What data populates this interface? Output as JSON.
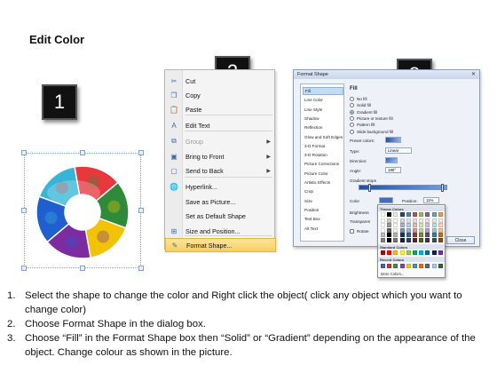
{
  "page": {
    "title": "Edit Color"
  },
  "badges": [
    "1",
    "2",
    "3"
  ],
  "context_menu": {
    "items": [
      {
        "icon": "cut-icon",
        "glyph": "✂",
        "label": "Cut",
        "submenu": false,
        "disabled": false,
        "highlighted": false
      },
      {
        "icon": "copy-icon",
        "glyph": "❐",
        "label": "Copy",
        "submenu": false,
        "disabled": false,
        "highlighted": false
      },
      {
        "icon": "paste-icon",
        "glyph": "📋",
        "label": "Paste",
        "submenu": false,
        "disabled": false,
        "highlighted": false
      },
      {
        "icon": "edit-text-icon",
        "glyph": "A",
        "label": "Edit Text",
        "submenu": false,
        "disabled": false,
        "highlighted": false
      },
      {
        "icon": "group-icon",
        "glyph": "⧉",
        "label": "Group",
        "submenu": true,
        "disabled": true,
        "highlighted": false
      },
      {
        "icon": "bring-to-front-icon",
        "glyph": "▣",
        "label": "Bring to Front",
        "submenu": true,
        "disabled": false,
        "highlighted": false
      },
      {
        "icon": "send-to-back-icon",
        "glyph": "▢",
        "label": "Send to Back",
        "submenu": true,
        "disabled": false,
        "highlighted": false
      },
      {
        "icon": "hyperlink-icon",
        "glyph": "🌐",
        "label": "Hyperlink...",
        "submenu": false,
        "disabled": false,
        "highlighted": false
      },
      {
        "icon": "",
        "glyph": "",
        "label": "Save as Picture...",
        "submenu": false,
        "disabled": false,
        "highlighted": false
      },
      {
        "icon": "",
        "glyph": "",
        "label": "Set as Default Shape",
        "submenu": false,
        "disabled": false,
        "highlighted": false
      },
      {
        "icon": "size-position-icon",
        "glyph": "⊞",
        "label": "Size and Position...",
        "submenu": false,
        "disabled": false,
        "highlighted": false
      },
      {
        "icon": "format-shape-icon",
        "glyph": "✎",
        "label": "Format Shape...",
        "submenu": false,
        "disabled": false,
        "highlighted": true
      }
    ]
  },
  "dialog": {
    "title": "Format Shape",
    "close_glyph": "✕",
    "nav": [
      "Fill",
      "Line Color",
      "Line Style",
      "Shadow",
      "Reflection",
      "Glow and Soft Edges",
      "3-D Format",
      "3-D Rotation",
      "Picture Corrections",
      "Picture Color",
      "Artistic Effects",
      "Crop",
      "Size",
      "Position",
      "Text Box",
      "Alt Text"
    ],
    "active_nav": "Fill",
    "section_title": "Fill",
    "fill_options": [
      {
        "label": "No fill",
        "selected": false
      },
      {
        "label": "Solid fill",
        "selected": false
      },
      {
        "label": "Gradient fill",
        "selected": true
      },
      {
        "label": "Picture or texture fill",
        "selected": false
      },
      {
        "label": "Pattern fill",
        "selected": false
      },
      {
        "label": "Slide background fill",
        "selected": false
      }
    ],
    "preset_colors_label": "Preset colors:",
    "type_label": "Type:",
    "type_value": "Linear",
    "direction_label": "Direction:",
    "angle_label": "Angle:",
    "angle_value": "180°",
    "gradient_stops_label": "Gradient stops",
    "color_label": "Color",
    "position_label": "Position:",
    "position_value": "11%",
    "brightness_label": "Brightness",
    "transparency_label": "Transparen",
    "rotate_label": "Rotate",
    "close_button": "Close"
  },
  "palette": {
    "theme_title": "Theme Colors",
    "standard_title": "Standard Colors",
    "recent_title": "Recent Colors",
    "more_colors": "More Colors...",
    "theme_top": [
      "#ffffff",
      "#000000",
      "#eeece1",
      "#1f497d",
      "#4f81bd",
      "#c0504d",
      "#9bbb59",
      "#8064a2",
      "#4bacc6",
      "#f79646"
    ],
    "standard": [
      "#c00000",
      "#ff0000",
      "#ffc000",
      "#ffff00",
      "#92d050",
      "#00b050",
      "#00b0f0",
      "#0070c0",
      "#002060",
      "#7030a0"
    ],
    "recent": [
      "#3366cc",
      "#cc3333",
      "#339933",
      "#9933cc",
      "#ffcc00",
      "#3399cc",
      "#ff6600",
      "#666666",
      "#99ccff",
      "#336633"
    ]
  },
  "ring": {
    "segment_colors": [
      "#e8383d",
      "#2e8b3a",
      "#f2c300",
      "#7e2aa0",
      "#1f5fcf",
      "#35b6d8"
    ]
  },
  "steps": [
    {
      "num": "1.",
      "text": "Select the shape to change the color and Right click the object( click any object which you want to change color)"
    },
    {
      "num": "2.",
      "text": "Choose Format Shape in the dialog box."
    },
    {
      "num": "3.",
      "text": "Choose “Fill” in the Format Shape box then “Solid” or “Gradient” depending on the appearance of the object. Change colour as shown in the picture."
    }
  ]
}
